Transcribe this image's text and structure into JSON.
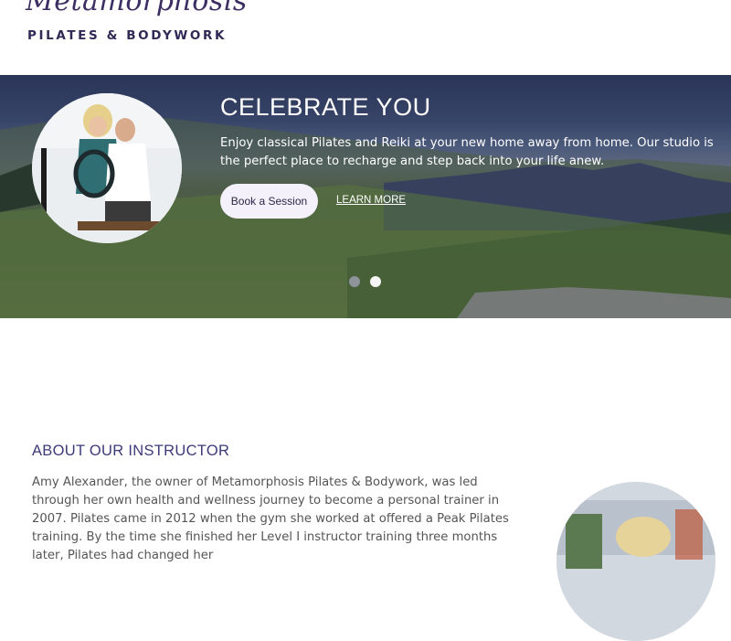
{
  "header": {
    "logo_script": "Metamorphosis",
    "logo_sub": "PILATES & BODYWORK"
  },
  "hero": {
    "title": "CELEBRATE YOU",
    "text": "Enjoy classical Pilates and Reiki at your new home away from home. Our studio is the perfect place to recharge and step back into your life anew.",
    "book_label": "Book a Session",
    "learn_label": "LEARN MORE",
    "slides": 2,
    "active_slide": 2
  },
  "about": {
    "title": "ABOUT OUR INSTRUCTOR",
    "text": "Amy Alexander, the owner of Metamorphosis Pilates & Bodywork, was led through her own health and wellness journey to become a personal trainer in 2007. Pilates came in 2012 when the gym she worked at offered a Peak Pilates training. By the time she finished her Level I instructor training three months later, Pilates had changed her"
  },
  "colors": {
    "brand_purple": "#3d3a78",
    "button_bg": "#f4f1fa"
  }
}
